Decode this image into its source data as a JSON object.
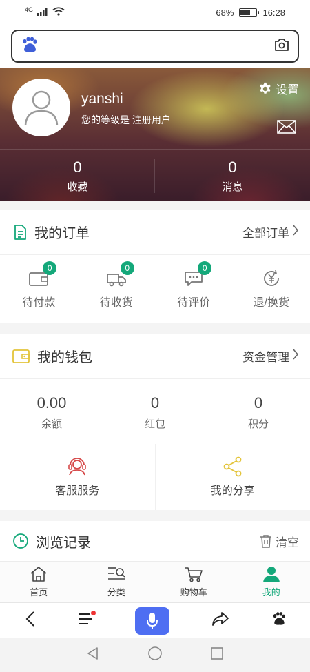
{
  "status_bar": {
    "network": "4G",
    "battery_percent": "68%",
    "battery_level": 0.68,
    "time": "16:28"
  },
  "search": {
    "placeholder": "",
    "logo_text": "du"
  },
  "profile": {
    "username": "yanshi",
    "level_text": "您的等级是 注册用户",
    "settings_label": "设置",
    "stats": [
      {
        "value": "0",
        "label": "收藏"
      },
      {
        "value": "0",
        "label": "消息"
      }
    ]
  },
  "orders": {
    "title": "我的订单",
    "link": "全部订单",
    "items": [
      {
        "label": "待付款",
        "icon": "wallet-icon",
        "badge": "0"
      },
      {
        "label": "待收货",
        "icon": "truck-icon",
        "badge": "0"
      },
      {
        "label": "待评价",
        "icon": "comment-icon",
        "badge": "0"
      },
      {
        "label": "退/换货",
        "icon": "yen-return-icon",
        "badge": ""
      }
    ]
  },
  "wallet": {
    "title": "我的钱包",
    "link": "资金管理",
    "items": [
      {
        "value": "0.00",
        "label": "余额"
      },
      {
        "value": "0",
        "label": "红包"
      },
      {
        "value": "0",
        "label": "积分"
      }
    ]
  },
  "services": [
    {
      "label": "客服服务",
      "icon": "headset-icon"
    },
    {
      "label": "我的分享",
      "icon": "share-icon"
    }
  ],
  "history": {
    "title": "浏览记录",
    "clear_label": "清空"
  },
  "tabbar": [
    {
      "label": "首页",
      "icon": "home-icon",
      "active": false
    },
    {
      "label": "分类",
      "icon": "category-icon",
      "active": false
    },
    {
      "label": "购物车",
      "icon": "cart-icon",
      "active": false
    },
    {
      "label": "我的",
      "icon": "user-icon",
      "active": true
    }
  ],
  "colors": {
    "accent": "#14a87a",
    "browser_mic": "#4e6ef2",
    "baidu_blue": "#3f5fd8"
  }
}
